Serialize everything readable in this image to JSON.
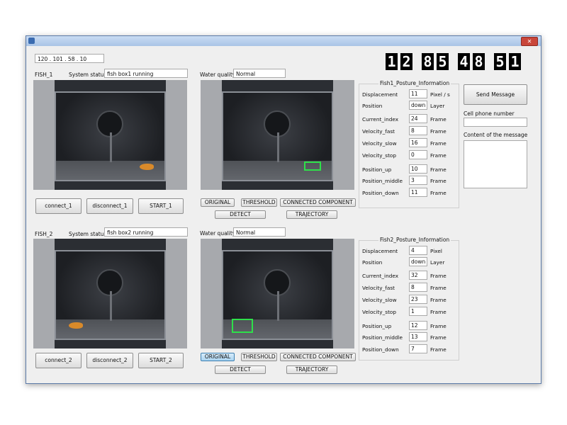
{
  "window": {
    "title": ""
  },
  "top": {
    "ip": "120 . 101 . 58 . 10",
    "header_title": "",
    "counter_digits": [
      "1",
      "2",
      "8",
      "5",
      "4",
      "8",
      "5",
      "1"
    ]
  },
  "fish1": {
    "label": "FISH_1",
    "status_label": "System status",
    "status_value": "fish box1 running",
    "wq_label": "Water quality",
    "wq_value": "Normal",
    "buttons": {
      "connect": "connect_1",
      "disconnect": "disconnect_1",
      "start": "START_1"
    }
  },
  "fish2": {
    "label": "FISH_2",
    "status_label": "System status",
    "status_value": "fish box2 running",
    "wq_label": "Water quality",
    "wq_value": "Normal",
    "buttons": {
      "connect": "connect_2",
      "disconnect": "disconnect_2",
      "start": "START_2"
    }
  },
  "view_buttons_1": {
    "original": "ORIGINAL",
    "threshold": "THRESHOLD",
    "connected": "CONNECTED COMPONENT",
    "detect": "DETECT",
    "trajectory": "TRAJECTORY"
  },
  "view_buttons_2": {
    "original": "ORIGINAL",
    "threshold": "THRESHOLD",
    "connected": "CONNECTED COMPONENT",
    "detect": "DETECT",
    "trajectory": "TRAJECTORY"
  },
  "posture1": {
    "title": "Fish1_Posture_Information",
    "rows": [
      {
        "label": "Displacement",
        "value": "11",
        "unit": "Pixel / s"
      },
      {
        "label": "Position",
        "value": "down",
        "unit": "Layer"
      },
      {
        "label": "Current_index",
        "value": "24",
        "unit": "Frame"
      },
      {
        "label": "Velocity_fast",
        "value": "8",
        "unit": "Frame"
      },
      {
        "label": "Velocity_slow",
        "value": "16",
        "unit": "Frame"
      },
      {
        "label": "Velocity_stop",
        "value": "0",
        "unit": "Frame"
      },
      {
        "label": "Position_up",
        "value": "10",
        "unit": "Frame"
      },
      {
        "label": "Position_middle",
        "value": "3",
        "unit": "Frame"
      },
      {
        "label": "Position_down",
        "value": "11",
        "unit": "Frame"
      }
    ]
  },
  "posture2": {
    "title": "Fish2_Posture_Information",
    "rows": [
      {
        "label": "Displacement",
        "value": "4",
        "unit": "Pixel"
      },
      {
        "label": "Position",
        "value": "down",
        "unit": "Layer"
      },
      {
        "label": "Current_index",
        "value": "32",
        "unit": "Frame"
      },
      {
        "label": "Velocity_fast",
        "value": "8",
        "unit": "Frame"
      },
      {
        "label": "Velocity_slow",
        "value": "23",
        "unit": "Frame"
      },
      {
        "label": "Velocity_stop",
        "value": "1",
        "unit": "Frame"
      },
      {
        "label": "Position_up",
        "value": "12",
        "unit": "Frame"
      },
      {
        "label": "Position_middle",
        "value": "13",
        "unit": "Frame"
      },
      {
        "label": "Position_down",
        "value": "7",
        "unit": "Frame"
      }
    ]
  },
  "message": {
    "send_label": "Send Message",
    "phone_label": "Cell phone number",
    "phone_value": "",
    "content_label": "Content of the message",
    "content_value": ""
  },
  "colors": {
    "detect_box": "#2ee04a",
    "fish": "#d98a2a",
    "active_button": "#aad3f1"
  }
}
